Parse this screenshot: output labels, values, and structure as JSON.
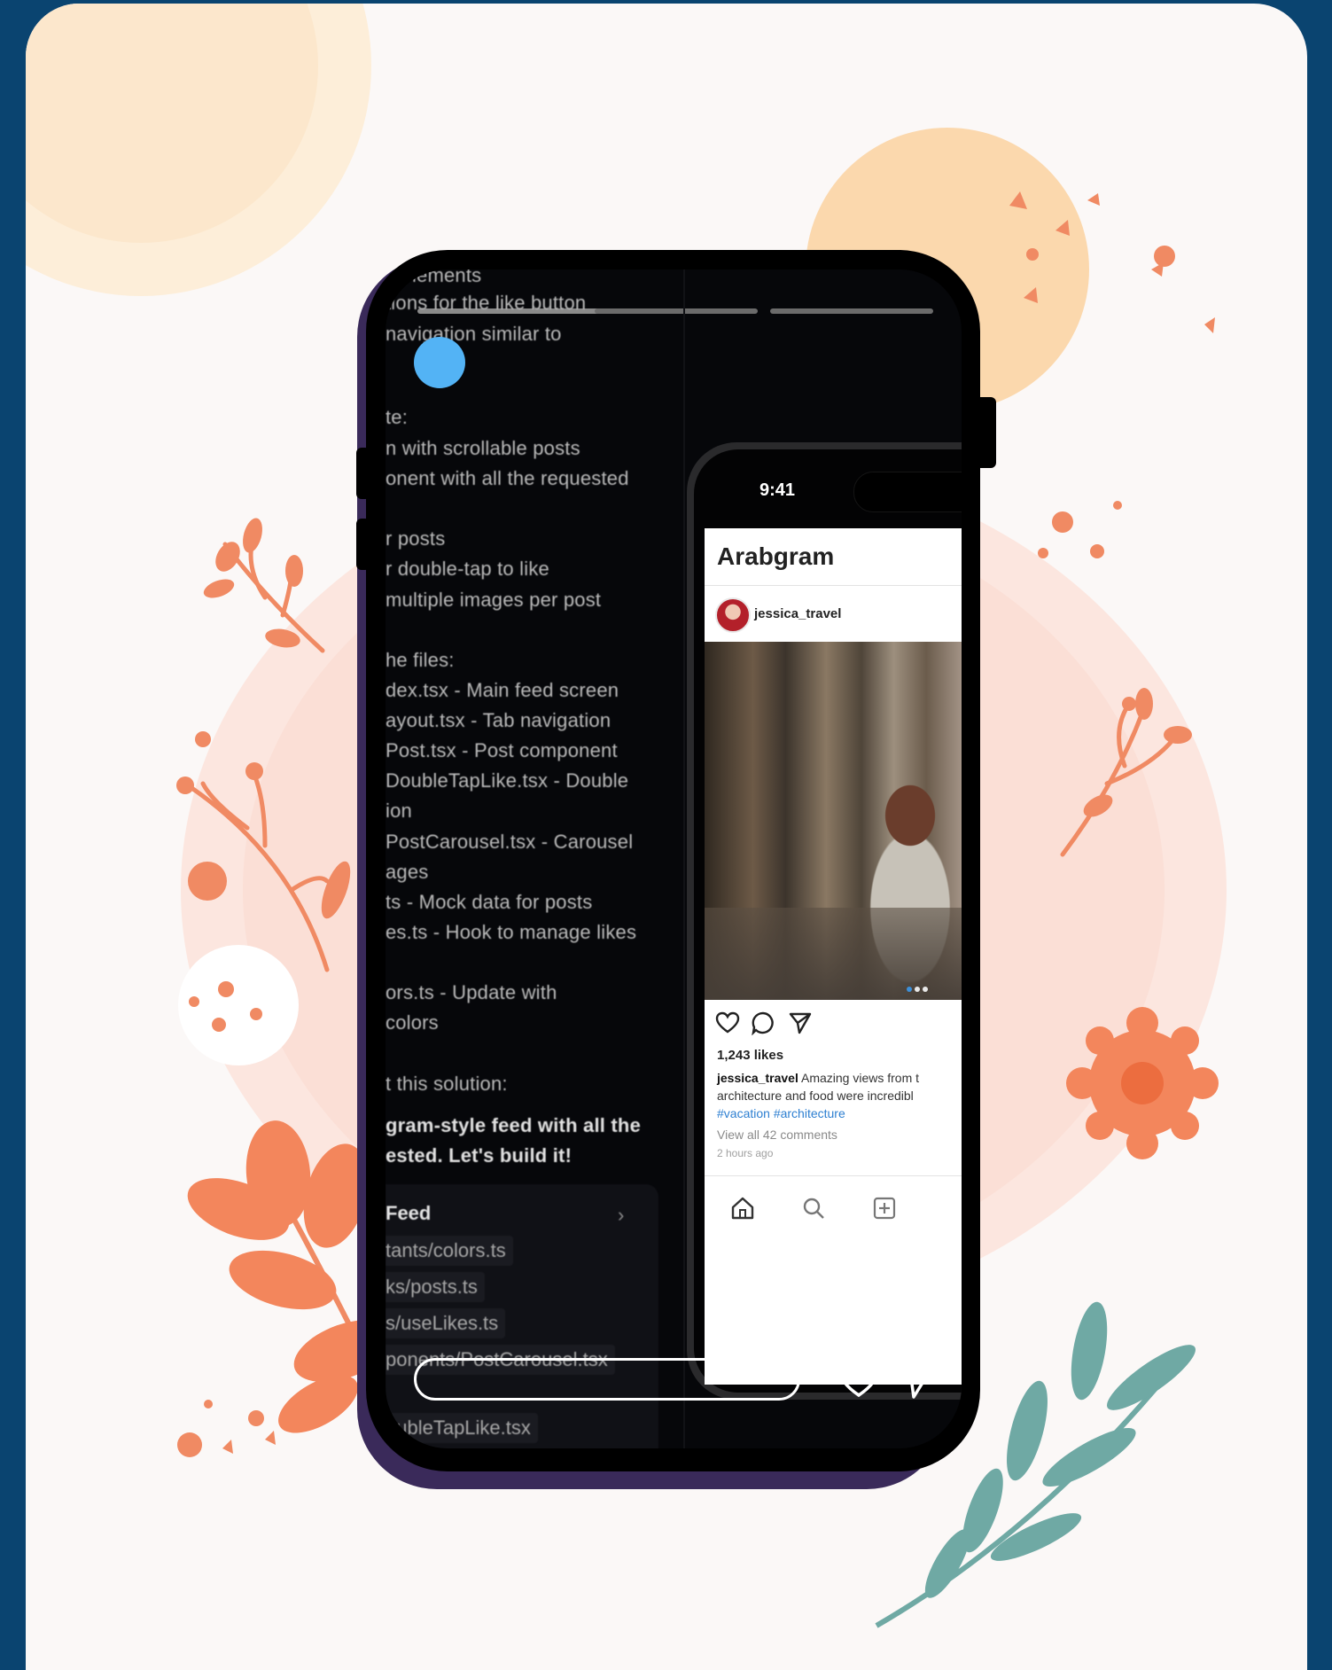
{
  "story": {
    "progress_segments": 3,
    "chat_lines": [
      "s elements",
      "tions for the like button",
      "navigation similar to",
      "te:",
      "n with scrollable posts",
      "onent with all the requested",
      "r posts",
      "r double-tap to like",
      "multiple images per post",
      "he files:",
      "dex.tsx - Main feed screen",
      "ayout.tsx - Tab navigation",
      "Post.tsx - Post component",
      "DoubleTapLike.tsx - Double",
      "ion",
      "PostCarousel.tsx - Carousel",
      "ages",
      "ts - Mock data for posts",
      "es.ts - Hook to manage likes",
      "ors.ts - Update with",
      "colors",
      "t this solution:",
      "gram-style feed with all the",
      "ested. Let's build it!"
    ],
    "files_panel": {
      "title": "Feed",
      "files": [
        "tants/colors.ts",
        "ks/posts.ts",
        "s/useLikes.ts",
        "ponents/PostCarousel.tsx",
        "oubleTapLike.tsx"
      ]
    }
  },
  "mockup": {
    "time": "9:41",
    "app_title": "Arabgram",
    "post": {
      "username": "jessica_travel",
      "likes": "1,243 likes",
      "caption_user": "jessica_travel",
      "caption_line1": "Amazing views from t",
      "caption_line2": "architecture and food were incredibl",
      "hashtags": "#vacation #architecture",
      "comments": "View all 42 comments",
      "time_ago": "2 hours ago"
    }
  },
  "colors": {
    "page_frame": "#0a4470",
    "card": "#fbf8f7",
    "blue_dot": "#53b3f5",
    "coral": "#f08a63",
    "peach": "#fbd8b4",
    "teal_leaf": "#6fa9a4"
  }
}
